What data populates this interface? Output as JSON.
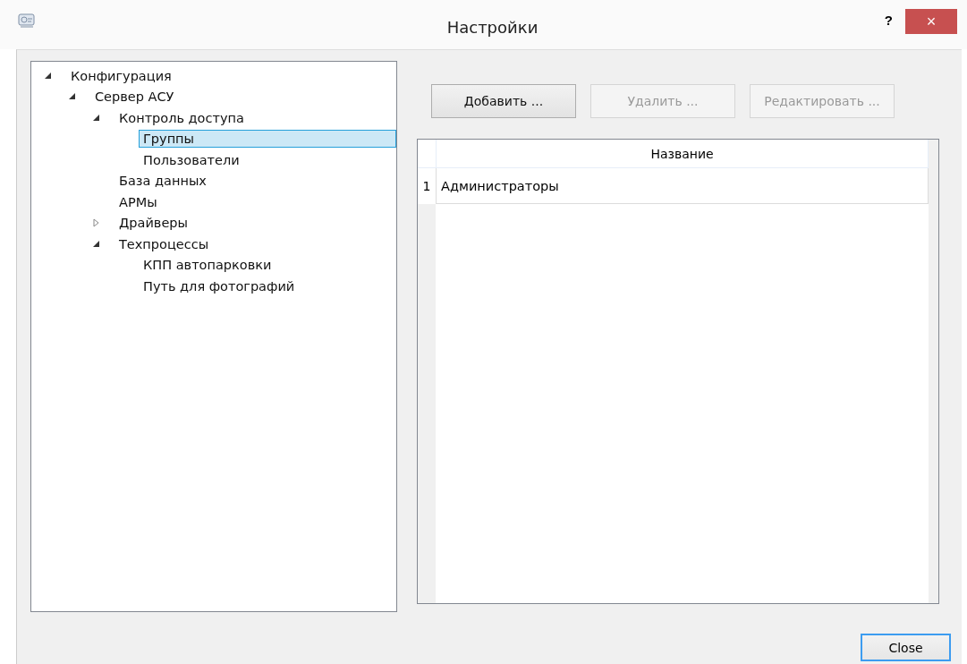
{
  "window": {
    "title": "Настройки",
    "help": "?",
    "close": "×"
  },
  "tree": [
    {
      "label": "Конфигурация",
      "expanded": true,
      "selected": false,
      "children": [
        {
          "label": "Сервер АСУ",
          "expanded": true,
          "selected": false,
          "children": [
            {
              "label": "Контроль доступа",
              "expanded": true,
              "selected": false,
              "children": [
                {
                  "label": "Группы",
                  "selected": true
                },
                {
                  "label": "Пользователи",
                  "selected": false
                }
              ]
            },
            {
              "label": "База данных",
              "selected": false
            },
            {
              "label": "АРМы",
              "selected": false
            },
            {
              "label": "Драйверы",
              "expanded": false,
              "selected": false
            },
            {
              "label": "Техпроцессы",
              "expanded": true,
              "selected": false,
              "children": [
                {
                  "label": "КПП автопарковки",
                  "selected": false
                },
                {
                  "label": "Путь для фотографий",
                  "selected": false
                }
              ]
            }
          ]
        }
      ]
    }
  ],
  "buttons": [
    {
      "label": "Добавить ...",
      "disabled": false
    },
    {
      "label": "Удалить ...",
      "disabled": true
    },
    {
      "label": "Редактировать ...",
      "disabled": true
    }
  ],
  "table": {
    "columns": [
      "Название"
    ],
    "rows": [
      {
        "number": "1",
        "cells": [
          "Администраторы"
        ]
      }
    ]
  },
  "footer_button": {
    "label": "Close",
    "focused": true
  }
}
